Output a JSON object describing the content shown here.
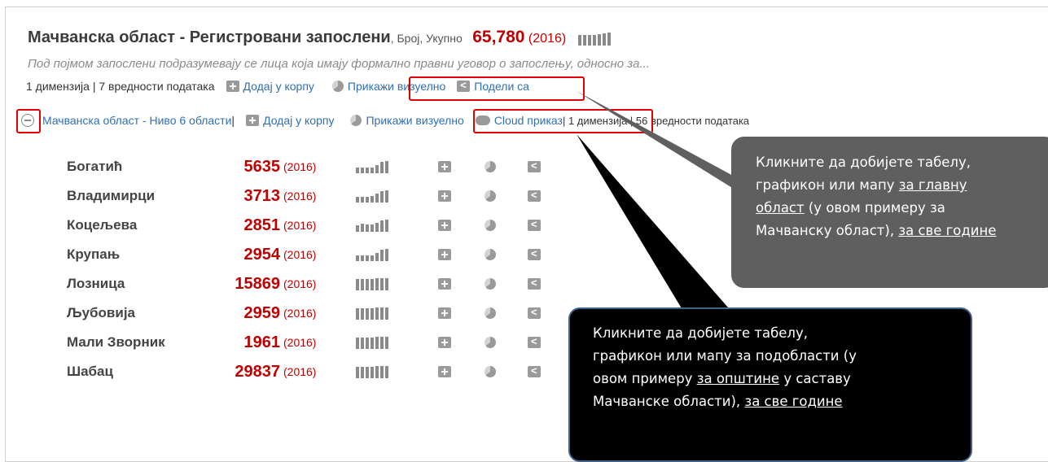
{
  "header": {
    "title": "Мачванска област - Регистровани запослени",
    "measure": ", Број, Укупно",
    "total_value": "65,780",
    "total_year": "(2016)",
    "description": "Под појмом запослени подразумевају се лица која имају формално правни уговор о запослењу, односно за...",
    "info": "1 димензија | 7 вредности података",
    "add_to_cart": "Додај у корпу",
    "show_visual": "Прикажи визуелно",
    "share": "Подели са"
  },
  "sublevel": {
    "link": "Мачванска област - Ниво 6 области",
    "separator": " |",
    "add_to_cart": "Додај у корпу",
    "show_visual": "Прикажи визуелно",
    "cloud": "Cloud приказ",
    "info": " | 1 димензија | 56 вредности података"
  },
  "municipalities": [
    {
      "name": "Богатић",
      "value": "5635",
      "year": "(2016)"
    },
    {
      "name": "Владимирци",
      "value": "3713",
      "year": "(2016)"
    },
    {
      "name": "Коцељева",
      "value": "2851",
      "year": "(2016)"
    },
    {
      "name": "Крупањ",
      "value": "2954",
      "year": "(2016)"
    },
    {
      "name": "Лозница",
      "value": "15869",
      "year": "(2016)"
    },
    {
      "name": "Љубовија",
      "value": "2959",
      "year": "(2016)"
    },
    {
      "name": "Мали Зворник",
      "value": "1961",
      "year": "(2016)"
    },
    {
      "name": "Шабац",
      "value": "29837",
      "year": "(2016)"
    }
  ],
  "callout_main": {
    "line1": "Кликните да добијете табелу,",
    "line2a": "графикон или мапу ",
    "line2b": "за главну",
    "line3a": "област",
    "line3b": " (у овом примеру за",
    "line4a": "Мачванску област), ",
    "line4b": "за све године"
  },
  "callout_sub": {
    "line1": "Кликните да добијете табелу,",
    "line2": "графикон или мапу за подобласти (у",
    "line3a": "овом примеру ",
    "line3b": "за општине",
    "line3c": " у саставу",
    "line4a": "Мачванске области), ",
    "line4b": "за све године"
  },
  "colors": {
    "value_red": "#c00000",
    "link_blue": "#2e6fb5",
    "highlight_red": "#e00000",
    "callout_main_bg": "#5f5f5f",
    "callout_sub_bg": "#000000"
  }
}
